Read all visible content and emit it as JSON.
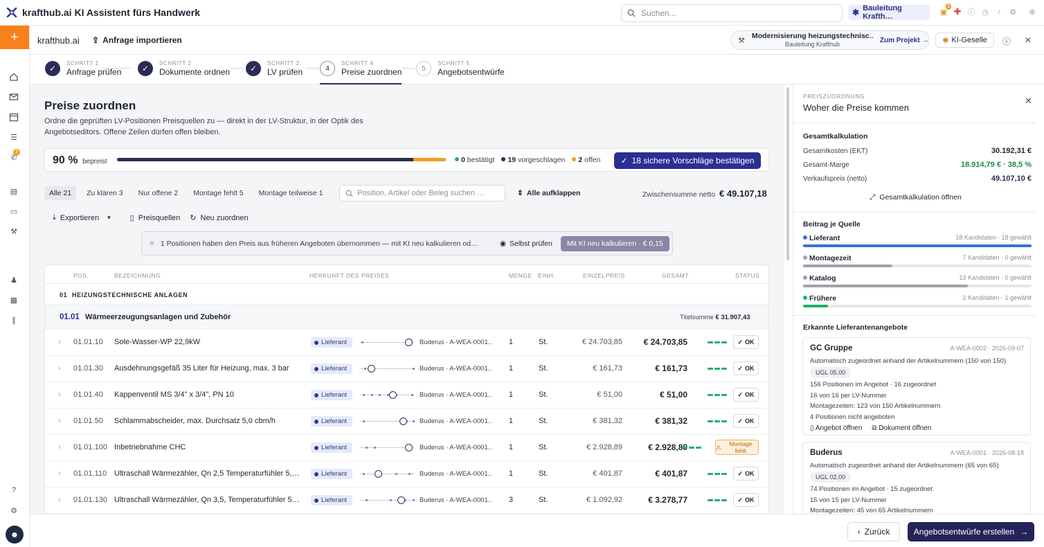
{
  "app": {
    "title": "krafthub.ai KI Assistent fürs Handwerk",
    "search_placeholder": "Suchen...",
    "org": "Bauleitung Krafth…",
    "notif_badge": "3"
  },
  "sidebar": {
    "phone_badge": "3"
  },
  "header": {
    "name": "krafthub.ai",
    "import": "Anfrage importieren",
    "project_title": "Modernisierung heizungstechnisc…",
    "project_sub": "Bauleitung Krafthub",
    "project_link": "Zum Projekt",
    "ki_button": "KI-Geselle"
  },
  "steps": [
    {
      "small": "SCHRITT 1",
      "label": "Anfrage prüfen",
      "num": "✓"
    },
    {
      "small": "SCHRITT 2",
      "label": "Dokumente ordnen",
      "num": "✓"
    },
    {
      "small": "SCHRITT 3",
      "label": "LV prüfen",
      "num": "✓"
    },
    {
      "small": "SCHRITT 4",
      "label": "Preise zuordnen",
      "num": "4"
    },
    {
      "small": "SCHRITT 5",
      "label": "Angebotsentwürfe",
      "num": "5"
    }
  ],
  "page": {
    "title": "Preise zuordnen",
    "desc": "Ordne die geprüften LV-Positionen Preisquellen zu — direkt in der LV-Struktur, in der Optik des Angebotseditors. Offene Zeilen dürfen offen bleiben.",
    "progress_pct": "90 %",
    "progress_value": 0.9,
    "progress_label": "bepreist",
    "legend": {
      "confirmed_n": "0",
      "confirmed": "bestätigt",
      "suggested_n": "19",
      "suggested": "vorgeschlagen",
      "open_n": "2",
      "open": "offen"
    },
    "confirm_button": "18 sichere Vorschläge bestätigen",
    "filters": [
      "Alle 21",
      "Zu klären 3",
      "Nur offene 2",
      "Montage fehlt 5",
      "Montage teilweise 1"
    ],
    "filter_search_placeholder": "Position, Artikel oder Beleg suchen …",
    "expand_all": "Alle aufklappen",
    "subtotal_label": "Zwischensumme netto",
    "subtotal_value": "€ 49.107,18",
    "tools": {
      "export": "Exportieren",
      "sources": "Preisquellen",
      "reassign": "Neu zuordnen"
    },
    "notice": {
      "text": "1 Positionen haben den Preis aus früheren Angeboten übernommen — mit KI neu kalkulieren od…",
      "self": "Selbst prüfen",
      "button": "Mit KI neu kalkulieren · € 0,15"
    }
  },
  "table": {
    "headers": {
      "pos": "POS.",
      "bez": "BEZEICHNUNG",
      "herkunft": "HERKUNFT DES PREISES",
      "menge": "MENGE",
      "einh": "EINH.",
      "ep": "EINZELPREIS",
      "gesamt": "GESAMT",
      "status": "STATUS"
    },
    "group1": {
      "num": "01",
      "label": "HEIZUNGSTECHNISCHE ANLAGEN"
    },
    "group2": {
      "num": "01.01",
      "label": "Wärmeerzeugungsanlagen und Zubehör",
      "sum_label": "Titelsumme",
      "sum": "€ 31.907,43"
    },
    "rows": [
      {
        "pos": "01.01.10",
        "bez": "Sole-Wasser-WP 22,9kW",
        "tag": "Lieferant",
        "src": "Buderus · A-WEA-0001…",
        "qty": "1",
        "unit": "St.",
        "ep": "€ 24.703,85",
        "gs": "€ 24.703,85",
        "status": "OK"
      },
      {
        "pos": "01.01.30",
        "bez": "Ausdehnungsgefäß 35 Liter für Heizung, max. 3 bar",
        "tag": "Lieferant",
        "src": "Buderus · A-WEA-0001…",
        "qty": "1",
        "unit": "St.",
        "ep": "€ 161,73",
        "gs": "€ 161,73",
        "status": "OK"
      },
      {
        "pos": "01.01.40",
        "bez": "Kappenventil MS 3/4\" x 3/4\", PN 10",
        "tag": "Lieferant",
        "src": "Buderus · A-WEA-0001…",
        "qty": "1",
        "unit": "St.",
        "ep": "€ 51,00",
        "gs": "€ 51,00",
        "status": "OK"
      },
      {
        "pos": "01.01.50",
        "bez": "Schlammabscheider, max. Durchsatz 5,0 cbm/h",
        "tag": "Lieferant",
        "src": "Buderus · A-WEA-0001…",
        "qty": "1",
        "unit": "St.",
        "ep": "€ 381,32",
        "gs": "€ 381,32",
        "status": "OK"
      },
      {
        "pos": "01.01.100",
        "bez": "Inbetriebnahme CHC",
        "tag": "Lieferant",
        "src": "Buderus · A-WEA-0001…",
        "qty": "1",
        "unit": "St.",
        "ep": "€ 2.928,89",
        "gs": "€ 2.928,89",
        "status": "Montage fehlt"
      },
      {
        "pos": "01.01.110",
        "bez": "Ultraschall Wärmezähler, Qn 2,5 Temperaturfühler 5,…",
        "tag": "Lieferant",
        "src": "Buderus · A-WEA-0001…",
        "qty": "1",
        "unit": "St.",
        "ep": "€ 401,87",
        "gs": "€ 401,87",
        "status": "OK"
      },
      {
        "pos": "01.01.130",
        "bez": "Ultraschall Wärmezähler, Qn 3,5, Temperaturfühler 5…",
        "tag": "Lieferant",
        "src": "Buderus · A-WEA-0001…",
        "qty": "3",
        "unit": "St.",
        "ep": "€ 1.092,92",
        "gs": "€ 3.278,77",
        "status": "OK"
      }
    ]
  },
  "panel": {
    "section": "PREISZUORDNUNG",
    "title": "Woher die Preise kommen",
    "calc_head": "Gesamtkalkulation",
    "kv": [
      {
        "k": "Gesamtkosten (EKT)",
        "v": "30.192,31 €"
      },
      {
        "k": "Gesamt-Marge",
        "v": "18.914,79 € · 38,5 %"
      },
      {
        "k": "Verkaufspreis (netto)",
        "v": "49.107,10 €"
      }
    ],
    "calc_link": "Gesamtkalkulation öffnen",
    "source_head": "Beitrag je Quelle",
    "sources": [
      {
        "name": "Lieferant",
        "meta": "18 Kandidaten · 18 gewählt",
        "share": 1.0,
        "color": "#3a6fd8"
      },
      {
        "name": "Montagezeit",
        "meta": "7 Kandidaten · 0 gewählt",
        "share": 0.39,
        "color": "#9ea3ab"
      },
      {
        "name": "Katalog",
        "meta": "13 Kandidaten · 0 gewählt",
        "share": 0.72,
        "color": "#9ea3ab"
      },
      {
        "name": "Frühere",
        "meta": "2 Kandidaten · 1 gewählt",
        "share": 0.11,
        "color": "#1fb16a"
      }
    ],
    "offers_head": "Erkannte Lieferantenangebote",
    "offers": [
      {
        "name": "GC Gruppe",
        "meta": "A-WEA-0002 · 2026-09-07",
        "auto": "Automatisch zugeordnet anhand der Artikelnummern (150 von 150)",
        "ugl": "UGL 05.00",
        "l1": "156 Positionen im Angebot · 16 zugeordnet",
        "l2": "16 von 16 per LV-Nummer",
        "l3": "Montagezeiten: 123 von 150 Artikelnummern",
        "l4": "4 Positionen nicht angeboten",
        "a1": "Angebot öffnen",
        "a2": "Dokument öffnen"
      },
      {
        "name": "Buderus",
        "meta": "A-WEA-0001 · 2026-08-18",
        "auto": "Automatisch zugeordnet anhand der Artikelnummern (65 von 65)",
        "ugl": "UGL 02.00",
        "l1": "74 Positionen im Angebot · 15 zugeordnet",
        "l2": "15 von 15 per LV-Nummer",
        "l3": "Montagezeiten: 45 von 65 Artikelnummern"
      }
    ]
  },
  "footer": {
    "back": "Zurück",
    "create": "Angebotsentwürfe erstellen"
  }
}
